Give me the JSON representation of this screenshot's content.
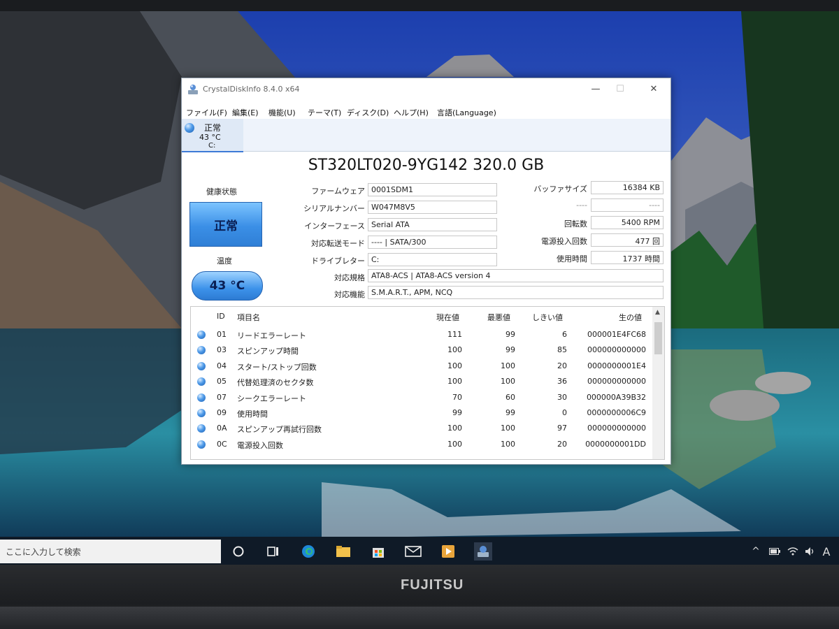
{
  "window": {
    "title": "CrystalDiskInfo 8.4.0 x64",
    "minimize": "—",
    "maximize": "☐",
    "close": "✕"
  },
  "menu": [
    "ファイル(F)",
    "編集(E)",
    "機能(U)",
    "テーマ(T)",
    "ディスク(D)",
    "ヘルプ(H)",
    "言語(Language)"
  ],
  "disk_tab": {
    "status": "正常",
    "temperature": "43 °C",
    "letter": "C:"
  },
  "model": "ST320LT020-9YG142 320.0 GB",
  "health": {
    "label": "健康状態",
    "status": "正常"
  },
  "temperature": {
    "label": "温度",
    "value": "43 °C"
  },
  "info": {
    "firmware_label": "ファームウェア",
    "firmware": "0001SDM1",
    "serial_label": "シリアルナンバー",
    "serial": "W047M8V5",
    "interface_label": "インターフェース",
    "interface": "Serial ATA",
    "transfer_label": "対応転送モード",
    "transfer": "---- | SATA/300",
    "drive_label": "ドライブレター",
    "drive": "C:",
    "standard_label": "対応規格",
    "standard": "ATA8-ACS | ATA8-ACS version 4",
    "features_label": "対応機能",
    "features": "S.M.A.R.T., APM, NCQ",
    "buffer_label": "バッファサイズ",
    "buffer": "16384 KB",
    "blank_label": "----",
    "blank": "----",
    "rotation_label": "回転数",
    "rotation": "5400 RPM",
    "power_count_label": "電源投入回数",
    "power_count": "477 回",
    "hours_label": "使用時間",
    "hours": "1737 時間"
  },
  "smart": {
    "headers": {
      "id": "ID",
      "name": "項目名",
      "current": "現在値",
      "worst": "最悪値",
      "threshold": "しきい値",
      "raw": "生の値"
    },
    "rows": [
      {
        "id": "01",
        "name": "リードエラーレート",
        "current": "111",
        "worst": "99",
        "threshold": "6",
        "raw": "000001E4FC68"
      },
      {
        "id": "03",
        "name": "スピンアップ時間",
        "current": "100",
        "worst": "99",
        "threshold": "85",
        "raw": "000000000000"
      },
      {
        "id": "04",
        "name": "スタート/ストップ回数",
        "current": "100",
        "worst": "100",
        "threshold": "20",
        "raw": "0000000001E4"
      },
      {
        "id": "05",
        "name": "代替処理済のセクタ数",
        "current": "100",
        "worst": "100",
        "threshold": "36",
        "raw": "000000000000"
      },
      {
        "id": "07",
        "name": "シークエラーレート",
        "current": "70",
        "worst": "60",
        "threshold": "30",
        "raw": "000000A39B32"
      },
      {
        "id": "09",
        "name": "使用時間",
        "current": "99",
        "worst": "99",
        "threshold": "0",
        "raw": "0000000006C9"
      },
      {
        "id": "0A",
        "name": "スピンアップ再試行回数",
        "current": "100",
        "worst": "100",
        "threshold": "97",
        "raw": "000000000000"
      },
      {
        "id": "0C",
        "name": "電源投入回数",
        "current": "100",
        "worst": "100",
        "threshold": "20",
        "raw": "0000000001DD"
      }
    ]
  },
  "taskbar": {
    "search_placeholder": "ここに入力して検索",
    "ime": "A"
  },
  "bezel": {
    "brand": "FUJITSU"
  },
  "colors": {
    "accent": "#3b8fe6",
    "taskbar": "#0f1a27",
    "window_bg": "#ffffff"
  }
}
